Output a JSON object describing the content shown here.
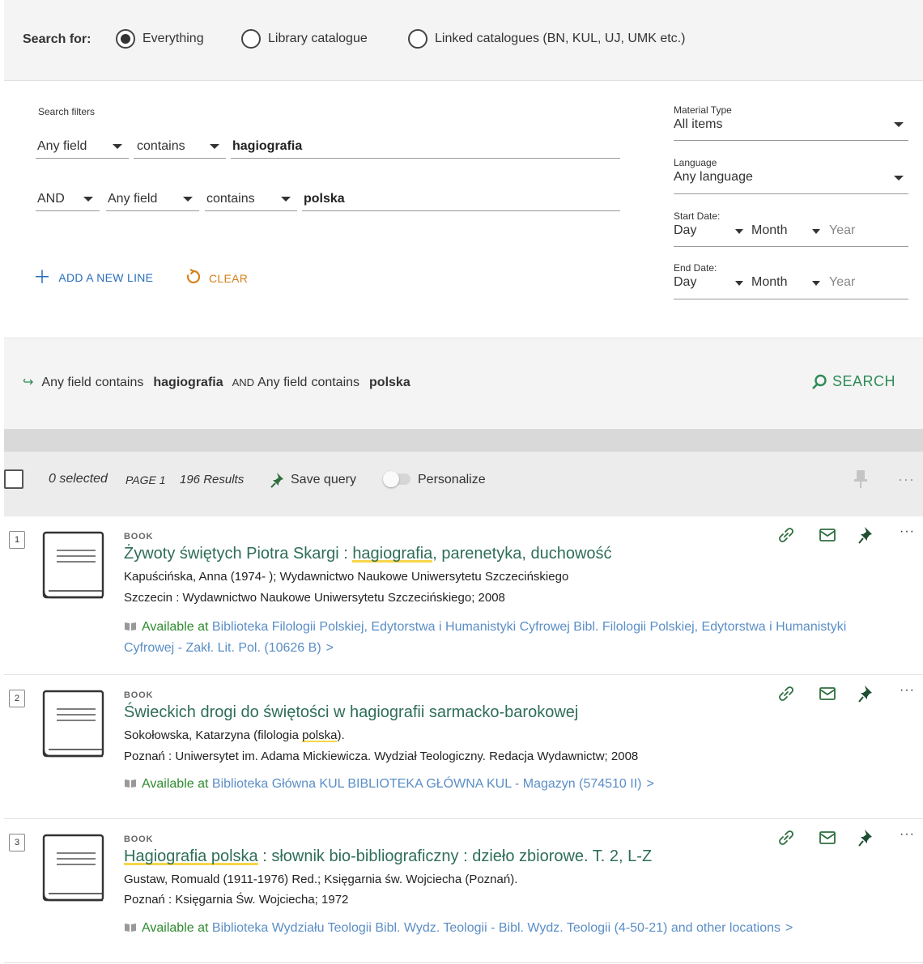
{
  "search_for": {
    "label": "Search for:",
    "options": [
      {
        "label": "Everything",
        "selected": true
      },
      {
        "label": "Library catalogue",
        "selected": false
      },
      {
        "label": "Linked catalogues (BN, KUL, UJ, UMK etc.)",
        "selected": false
      }
    ]
  },
  "advanced": {
    "filters_title": "Search filters",
    "line1": {
      "field": "Any field",
      "operator": "contains",
      "term": "hagiografia"
    },
    "line2": {
      "boolean": "AND",
      "field": "Any field",
      "operator": "contains",
      "term": "polska"
    },
    "add_line": "ADD A NEW LINE",
    "clear": "CLEAR",
    "material_type": {
      "label": "Material Type",
      "value": "All items"
    },
    "language": {
      "label": "Language",
      "value": "Any language"
    },
    "start_date": {
      "label": "Start Date:",
      "day": "Day",
      "month": "Month",
      "year": "Year"
    },
    "end_date": {
      "label": "End Date:",
      "day": "Day",
      "month": "Month",
      "year": "Year"
    }
  },
  "summary": {
    "f1": "Any field",
    "op1": "contains",
    "t1": "hagiografia",
    "bool": "AND",
    "f2": "Any field",
    "op2": "contains",
    "t2": "polska",
    "search_label": "SEARCH"
  },
  "toolbar": {
    "selected": "0 selected",
    "page": "PAGE 1",
    "results": "196 Results",
    "save_query": "Save query",
    "personalize": "Personalize",
    "more": "···"
  },
  "results": [
    {
      "num": "1",
      "type": "BOOK",
      "title_parts": [
        "Żywoty świętych Piotra Skargi : ",
        "hagiografia",
        ", parenetyka, duchowość"
      ],
      "author": "Kapuścińska, Anna (1974- ); Wydawnictwo Naukowe Uniwersytetu Szczecińskiego",
      "publisher": "Szczecin : Wydawnictwo Naukowe Uniwersytetu Szczecińskiego; 2008",
      "available": "Available at",
      "location": "Biblioteka Filologii Polskiej, Edytorstwa i Humanistyki Cyfrowej  Bibl. Filologii Polskiej, Edytorstwa i Humanistyki Cyfrowej - Zakł. Lit. Pol. (10626 B)",
      "chev": ">"
    },
    {
      "num": "2",
      "type": "BOOK",
      "title": "Świeckich drogi do świętości w hagiografii sarmacko-barokowej",
      "author_parts": [
        "Sokołowska, Katarzyna (filologia ",
        "polska",
        ")."
      ],
      "publisher": "Poznań : Uniwersytet im. Adama Mickiewicza. Wydział Teologiczny. Redacja Wydawnictw; 2008",
      "available": "Available at",
      "location": "Biblioteka Główna KUL  BIBLIOTEKA GŁÓWNA KUL - Magazyn (574510 II)",
      "chev": ">"
    },
    {
      "num": "3",
      "type": "BOOK",
      "title_parts": [
        "Hagiografia polska",
        " : słownik bio-bibliograficzny : dzieło zbiorowe. T. 2, L-Z"
      ],
      "author": "Gustaw, Romuald (1911-1976) Red.; Księgarnia św. Wojciecha (Poznań).",
      "publisher": "Poznań : Księgarnia Św. Wojciecha; 1972",
      "available": "Available at",
      "location": "Biblioteka Wydziału Teologii  Bibl. Wydz. Teologii - Bibl. Wydz. Teologii (4-50-21) and other locations",
      "chev": ">"
    }
  ],
  "result_more": "···"
}
